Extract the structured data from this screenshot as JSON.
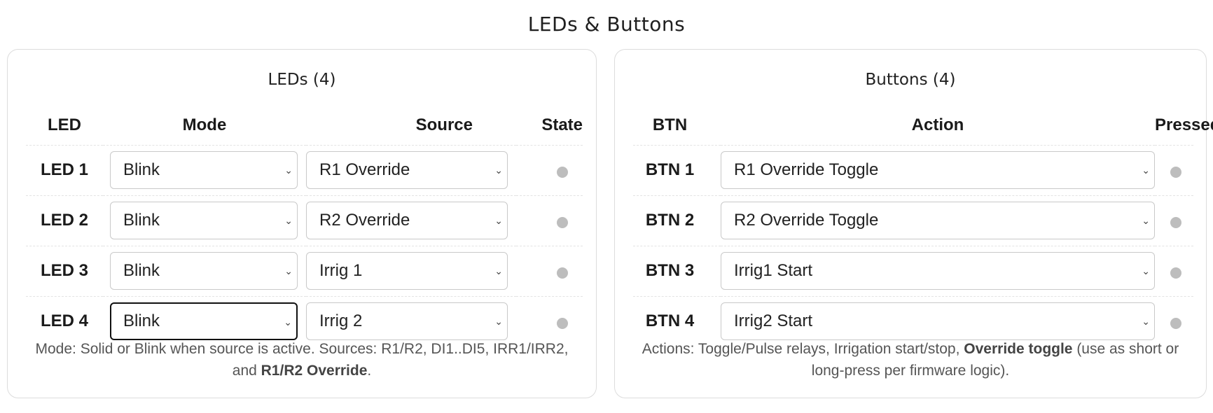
{
  "page": {
    "title": "LEDs & Buttons"
  },
  "leds": {
    "title": "LEDs (4)",
    "headers": {
      "led": "LED",
      "mode": "Mode",
      "source": "Source",
      "state": "State"
    },
    "rows": [
      {
        "label": "LED 1",
        "mode": "Blink",
        "source": "R1 Override"
      },
      {
        "label": "LED 2",
        "mode": "Blink",
        "source": "R2 Override"
      },
      {
        "label": "LED 3",
        "mode": "Blink",
        "source": "Irrig 1"
      },
      {
        "label": "LED 4",
        "mode": "Blink",
        "source": "Irrig 2"
      }
    ],
    "note": {
      "text": "Mode: Solid or Blink when source is active. Sources: R1/R2, DI1..DI5, IRR1/IRR2, and ",
      "bold": "R1/R2 Override",
      "end": "."
    }
  },
  "buttons": {
    "title": "Buttons (4)",
    "headers": {
      "btn": "BTN",
      "action": "Action",
      "pressed": "Pressed"
    },
    "rows": [
      {
        "label": "BTN 1",
        "action": "R1 Override Toggle"
      },
      {
        "label": "BTN 2",
        "action": "R2 Override Toggle"
      },
      {
        "label": "BTN 3",
        "action": "Irrig1 Start"
      },
      {
        "label": "BTN 4",
        "action": "Irrig2 Start"
      }
    ],
    "note": {
      "text": "Actions: Toggle/Pulse relays, Irrigation start/stop, ",
      "bold": "Override toggle",
      "end": " (use as short or long-press per firmware logic)."
    }
  },
  "icons": {
    "select": "chevron-down-icon",
    "state": "state-indicator-dot-icon"
  },
  "colors": {
    "indicator_off": "#bdbdbd",
    "focus_border": "#111111",
    "border": "#c9c9c9"
  }
}
